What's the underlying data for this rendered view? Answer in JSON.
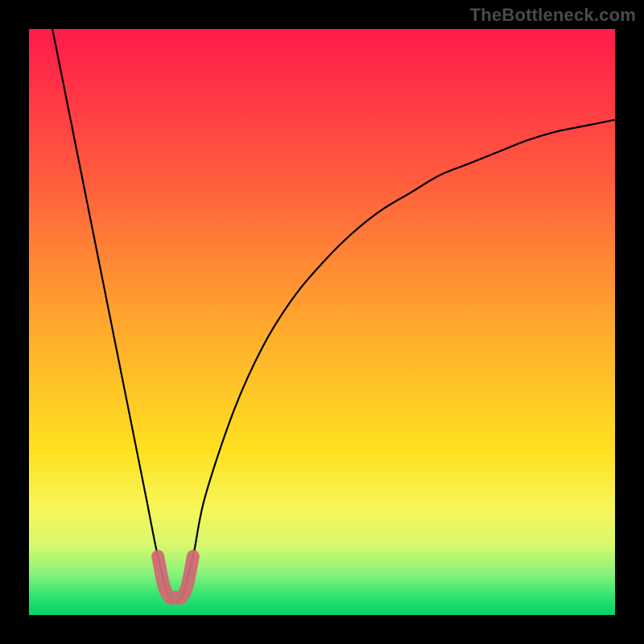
{
  "watermark": {
    "text": "TheBottleneck.com"
  },
  "chart_data": {
    "type": "line",
    "title": "",
    "xlabel": "",
    "ylabel": "",
    "xlim": [
      0,
      100
    ],
    "ylim": [
      0,
      100
    ],
    "series": [
      {
        "name": "black-curve",
        "color": "#000000",
        "x": [
          4,
          6,
          8,
          10,
          12,
          14,
          16,
          18,
          20,
          22,
          24,
          26,
          28,
          30,
          35,
          40,
          45,
          50,
          55,
          60,
          65,
          70,
          75,
          80,
          85,
          90,
          95,
          100
        ],
        "y": [
          100,
          90,
          80,
          70,
          60,
          50,
          40,
          30,
          20,
          10,
          3,
          3,
          10,
          20,
          35,
          46,
          54,
          60,
          65,
          69,
          72,
          75,
          77,
          79,
          81,
          82.5,
          83.5,
          84.5
        ]
      },
      {
        "name": "pink-segment",
        "color": "#cf6a74",
        "x": [
          22,
          23,
          24,
          25,
          26,
          27,
          28
        ],
        "y": [
          10,
          5,
          3,
          3,
          3,
          5,
          10
        ]
      }
    ],
    "colors": {
      "gradient_top": "#ff1a4a",
      "gradient_mid": "#ffe120",
      "gradient_bottom": "#06d168",
      "frame": "#000000",
      "pink": "#cf6a74"
    }
  }
}
